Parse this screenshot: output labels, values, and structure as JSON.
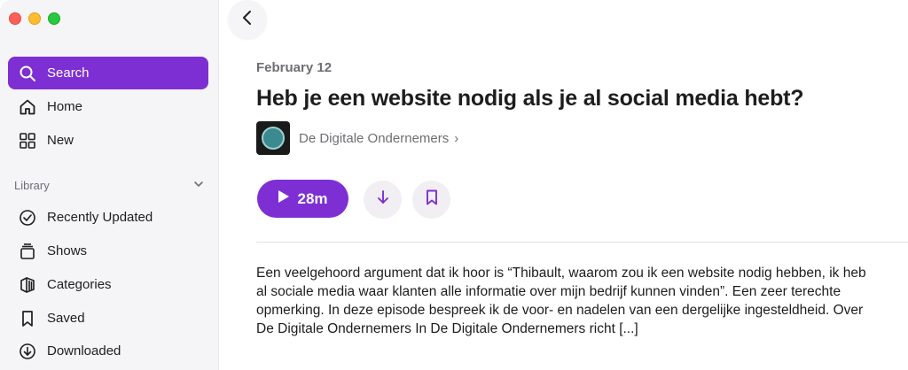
{
  "sidebar": {
    "items": [
      {
        "label": "Search",
        "icon": "search-icon",
        "active": true
      },
      {
        "label": "Home",
        "icon": "home-icon"
      },
      {
        "label": "New",
        "icon": "grid-icon"
      }
    ],
    "library_header": "Library",
    "library_items": [
      {
        "label": "Recently Updated",
        "icon": "check-circle-icon"
      },
      {
        "label": "Shows",
        "icon": "shows-stack-icon"
      },
      {
        "label": "Categories",
        "icon": "categories-icon"
      },
      {
        "label": "Saved",
        "icon": "bookmark-icon"
      },
      {
        "label": "Downloaded",
        "icon": "download-circle-icon"
      }
    ]
  },
  "episode": {
    "date": "February 12",
    "title": "Heb je een website nodig als je al social media hebt?",
    "show_name": "De Digitale Ondernemers",
    "show_chevron": "›",
    "play_label": "28m",
    "description": "Een veelgehoord argument dat ik hoor is “Thibault, waarom zou ik een website nodig hebben, ik heb al sociale media waar klanten alle informatie over mijn bedrijf kunnen vinden”. Een zeer terechte opmerking. In deze episode bespreek ik de voor- en nadelen van een dergelijke ingesteldheid. Over De Digitale Ondernemers In De Digitale Ondernemers richt [...]"
  },
  "colors": {
    "accent": "#7d2fd3",
    "sidebar_bg": "#f5f4f6"
  }
}
